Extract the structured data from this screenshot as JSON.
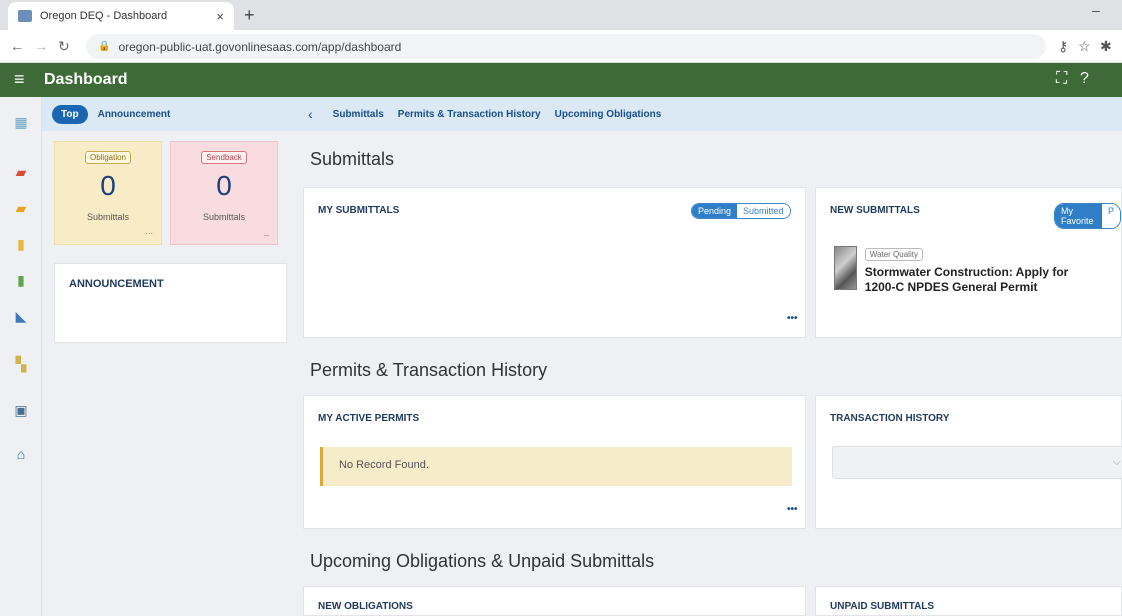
{
  "browser": {
    "tab_title": "Oregon DEQ - Dashboard",
    "tab_close": "×",
    "new_tab": "+",
    "minimize": "–",
    "url": "oregon-public-uat.govonlinesaas.com/app/dashboard"
  },
  "header": {
    "title": "Dashboard"
  },
  "left": {
    "tabs": [
      "Top",
      "Announcement"
    ],
    "cards": [
      {
        "tag": "Obligation",
        "count": "0",
        "label": "Submittals",
        "dots": "..."
      },
      {
        "tag": "Sendback",
        "count": "0",
        "label": "Submittals",
        "dots": "_"
      }
    ],
    "announcement_heading": "ANNOUNCEMENT"
  },
  "subnav": {
    "links": [
      "Submittals",
      "Permits & Transaction History",
      "Upcoming Obligations"
    ]
  },
  "sections": {
    "submittals": "Submittals",
    "permits": "Permits & Transaction History",
    "upcoming": "Upcoming Obligations & Unpaid Submittals"
  },
  "my_submittals": {
    "heading": "MY SUBMITTALS",
    "toggle_on": "Pending",
    "toggle_off": "Submitted",
    "more": "•••"
  },
  "new_submittals": {
    "heading": "NEW SUBMITTALS",
    "toggle_on": "My Favorite",
    "toggle_off": "P",
    "item_tag": "Water Quality",
    "item_title": "Stormwater Construction: Apply for 1200-C NPDES General Permit"
  },
  "active_permits": {
    "heading": "MY ACTIVE PERMITS",
    "empty": "No Record Found.",
    "more": "•••"
  },
  "transaction_history": {
    "heading": "TRANSACTION HISTORY"
  },
  "bottom": {
    "new_obligations": "NEW OBLIGATIONS",
    "unpaid_submittals": "UNPAID SUBMITTALS"
  },
  "colors": {
    "header_green": "#3d6a36",
    "link_blue": "#1a4f8a",
    "pill_blue": "#1a66b3",
    "obligation_bg": "#f8ecc7",
    "sendback_bg": "#f9dcdf"
  }
}
